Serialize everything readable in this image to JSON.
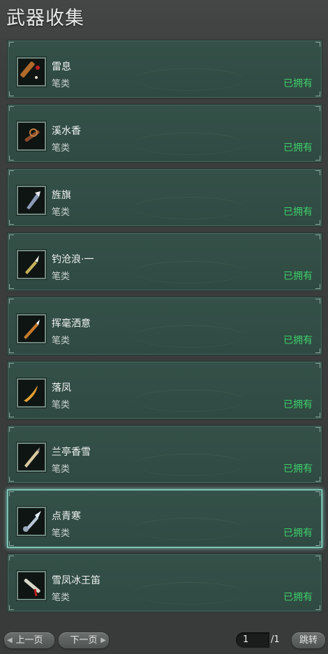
{
  "title": "武器收集",
  "items": [
    {
      "name": "雷息",
      "category": "笔类",
      "status": "已拥有",
      "icon": "flute-weapon-icon",
      "color": "#b06a2a",
      "selected": false
    },
    {
      "name": "溪水香",
      "category": "笔类",
      "status": "已拥有",
      "icon": "ornate-flute-icon",
      "color": "#8a4a2a",
      "selected": false
    },
    {
      "name": "旌旗",
      "category": "笔类",
      "status": "已拥有",
      "icon": "banner-brush-icon",
      "color": "#8a9ab8",
      "selected": false
    },
    {
      "name": "钓沧浪·一",
      "category": "笔类",
      "status": "已拥有",
      "icon": "golden-brush-icon",
      "color": "#c7b25a",
      "selected": false
    },
    {
      "name": "挥毫洒意",
      "category": "笔类",
      "status": "已拥有",
      "icon": "orange-brush-icon",
      "color": "#c87a2a",
      "selected": false
    },
    {
      "name": "落凤",
      "category": "笔类",
      "status": "已拥有",
      "icon": "phoenix-brush-icon",
      "color": "#e0a030",
      "selected": false
    },
    {
      "name": "兰亭香雪",
      "category": "笔类",
      "status": "已拥有",
      "icon": "white-brush-icon",
      "color": "#d8c9a0",
      "selected": false
    },
    {
      "name": "点青寒",
      "category": "笔类",
      "status": "已拥有",
      "icon": "ice-brush-icon",
      "color": "#b8c8d8",
      "selected": true
    },
    {
      "name": "雪凤冰王笛",
      "category": "笔类",
      "status": "已拥有",
      "icon": "snow-flute-icon",
      "color": "#d8d8c8",
      "selected": false
    }
  ],
  "pagination": {
    "prev_label": "上一页",
    "next_label": "下一页",
    "current_page": "1",
    "total_pages": "/1",
    "jump_label": "跳转"
  },
  "colors": {
    "owned": "#3fcf6a",
    "item_bg": "#345148",
    "selected_border": "#8fd6c8"
  }
}
